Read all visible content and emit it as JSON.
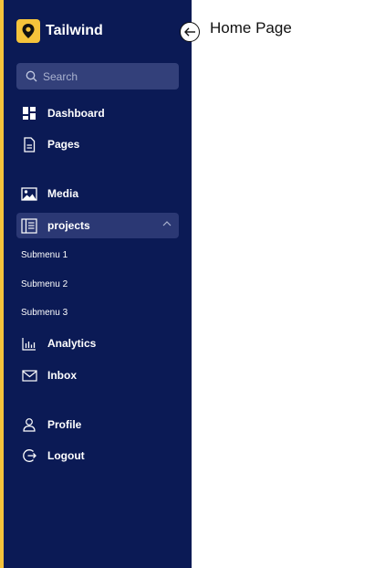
{
  "brand": {
    "name": "Tailwind",
    "accent_color": "#f5c33b",
    "logo_icon": "map-pin-icon"
  },
  "sidebar_color": "#0b1a55",
  "search": {
    "placeholder": "Search",
    "value": "",
    "icon": "search-icon"
  },
  "nav": {
    "dashboard": {
      "label": "Dashboard",
      "icon": "dashboard-icon"
    },
    "pages": {
      "label": "Pages",
      "icon": "document-icon"
    },
    "media": {
      "label": "Media",
      "icon": "image-icon"
    },
    "projects": {
      "label": "projects",
      "icon": "projects-icon",
      "expanded": true,
      "submenu": [
        "Submenu 1",
        "Submenu 2",
        "Submenu 3"
      ]
    },
    "analytics": {
      "label": "Analytics",
      "icon": "bar-chart-icon"
    },
    "inbox": {
      "label": "Inbox",
      "icon": "mail-icon"
    },
    "profile": {
      "label": "Profile",
      "icon": "user-icon"
    },
    "logout": {
      "label": "Logout",
      "icon": "logout-icon"
    }
  },
  "collapse_button": {
    "icon": "arrow-left-circle-icon"
  },
  "main": {
    "title": "Home Page"
  }
}
